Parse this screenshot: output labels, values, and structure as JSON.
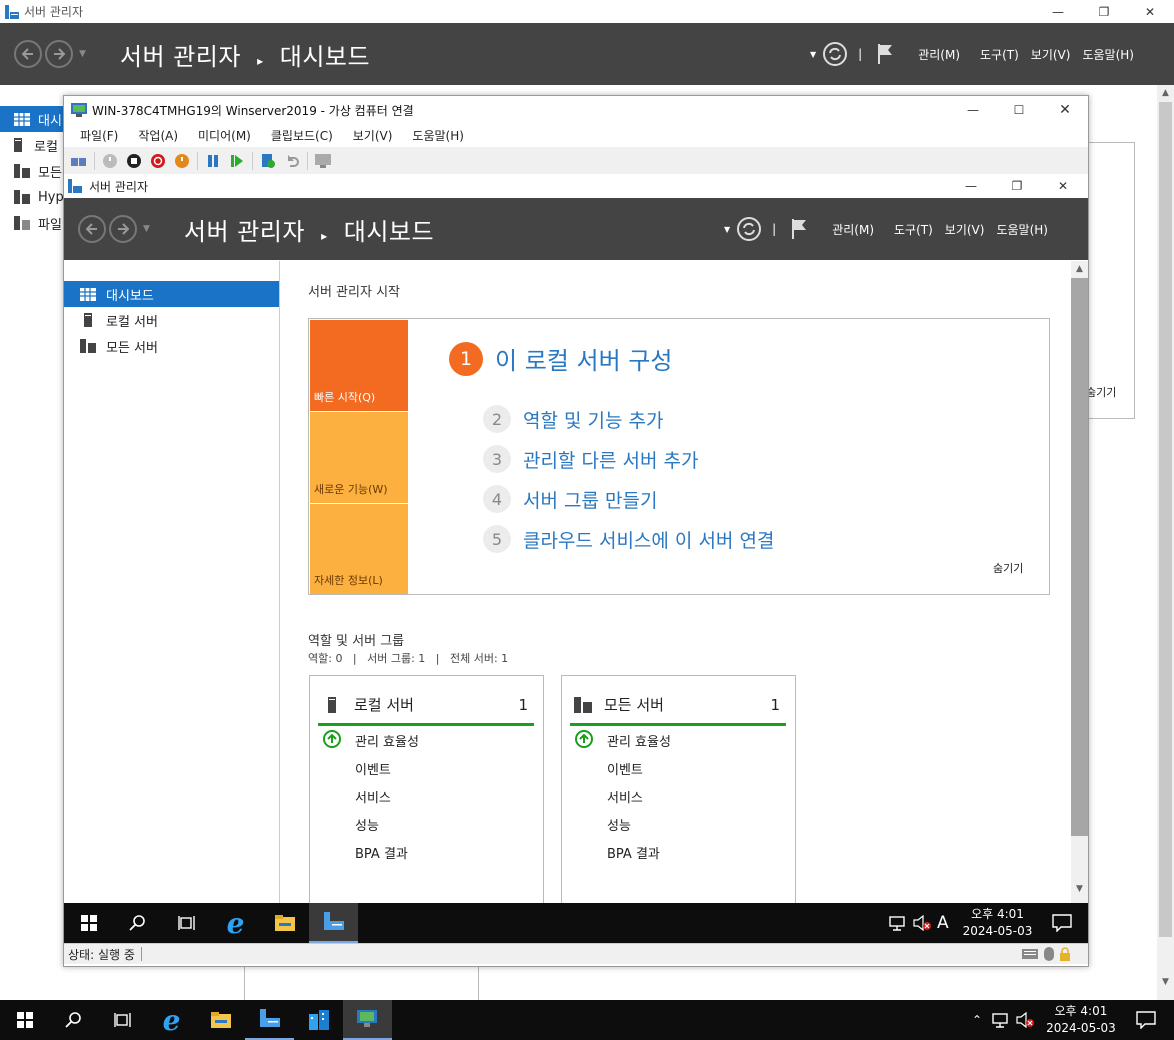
{
  "outer": {
    "title": "서버 관리자",
    "header_title_a": "서버 관리자",
    "header_title_b": "대시보드",
    "menu": [
      "관리(M)",
      "도구(T)",
      "보기(V)",
      "도움말(H)"
    ],
    "nav": [
      "대시",
      "로컬",
      "모든",
      "Hyp",
      "파일"
    ],
    "right_label": "숨기기"
  },
  "vm": {
    "title": "WIN-378C4TMHG19의 Winserver2019 - 가상 컴퓨터 연결",
    "menu": [
      "파일(F)",
      "작업(A)",
      "미디어(M)",
      "클립보드(C)",
      "보기(V)",
      "도움말(H)"
    ],
    "status": "상태: 실행 중"
  },
  "inner": {
    "title": "서버 관리자",
    "header_title_a": "서버 관리자",
    "header_title_b": "대시보드",
    "menu": [
      "관리(M)",
      "도구(T)",
      "보기(V)",
      "도움말(H)"
    ],
    "nav": [
      "대시보드",
      "로컬 서버",
      "모든 서버"
    ],
    "welcome": "서버 관리자 시작",
    "tiles": [
      "빠른 시작(Q)",
      "새로운 기능(W)",
      "자세한 정보(L)"
    ],
    "steps": [
      {
        "num": "1",
        "label": "이 로컬 서버 구성"
      },
      {
        "num": "2",
        "label": "역할 및 기능 추가"
      },
      {
        "num": "3",
        "label": "관리할 다른 서버 추가"
      },
      {
        "num": "4",
        "label": "서버 그룹 만들기"
      },
      {
        "num": "5",
        "label": "클라우드 서비스에 이 서버 연결"
      }
    ],
    "hide": "숨기기",
    "groups_title": "역할 및 서버 그룹",
    "groups_summary": "역할: 0   |   서버 그룹: 1   |   전체 서버: 1",
    "cards": [
      {
        "title": "로컬 서버",
        "count": "1",
        "rows": [
          "관리 효율성",
          "이벤트",
          "서비스",
          "성능",
          "BPA 결과"
        ]
      },
      {
        "title": "모든 서버",
        "count": "1",
        "rows": [
          "관리 효율성",
          "이벤트",
          "서비스",
          "성능",
          "BPA 결과"
        ]
      }
    ],
    "clock_time": "오후 4:01",
    "clock_date": "2024-05-03",
    "ime": "A"
  },
  "taskbar": {
    "clock_time": "오후 4:01",
    "clock_date": "2024-05-03"
  },
  "colors": {
    "accent": "#1a73c6",
    "header": "#444444",
    "tile_orange": "#f26b21",
    "tile_light": "#fbb040",
    "ok_green": "#1ba01b",
    "link_blue": "#2a78c2"
  }
}
